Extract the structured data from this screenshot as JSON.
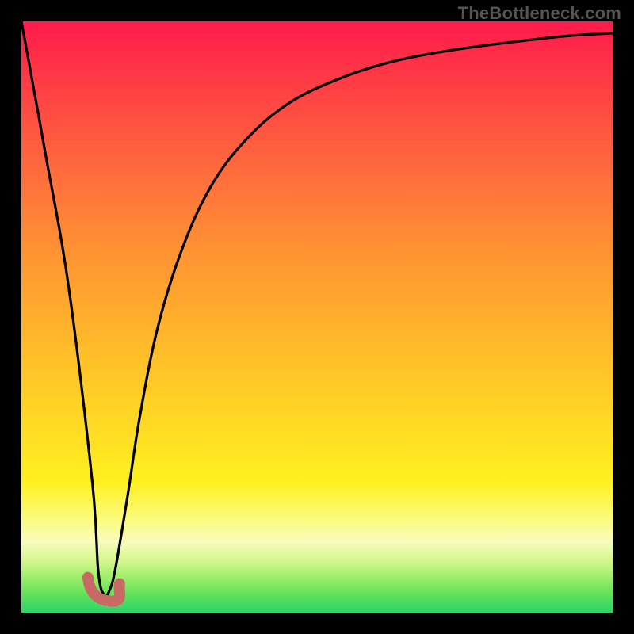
{
  "watermark": "TheBottleneck.com",
  "colors": {
    "frame": "#000000",
    "curve": "#000000",
    "hook": "#c76a63"
  },
  "chart_data": {
    "type": "line",
    "title": "",
    "xlabel": "",
    "ylabel": "",
    "xlim": [
      0,
      100
    ],
    "ylim": [
      0,
      100
    ],
    "grid": false,
    "legend": false,
    "series": [
      {
        "name": "bottleneck-curve",
        "x": [
          0,
          4,
          8,
          12,
          13,
          14,
          15,
          16,
          18,
          20,
          23,
          27,
          32,
          38,
          45,
          53,
          62,
          72,
          83,
          92,
          100
        ],
        "values": [
          100,
          78,
          55,
          22,
          7,
          3,
          4,
          8,
          20,
          33,
          48,
          61,
          72,
          80,
          86,
          90,
          93,
          95,
          96.5,
          97.5,
          98
        ]
      }
    ],
    "annotations": [
      {
        "name": "min-hook",
        "x": 14.2,
        "y": 3
      }
    ]
  }
}
